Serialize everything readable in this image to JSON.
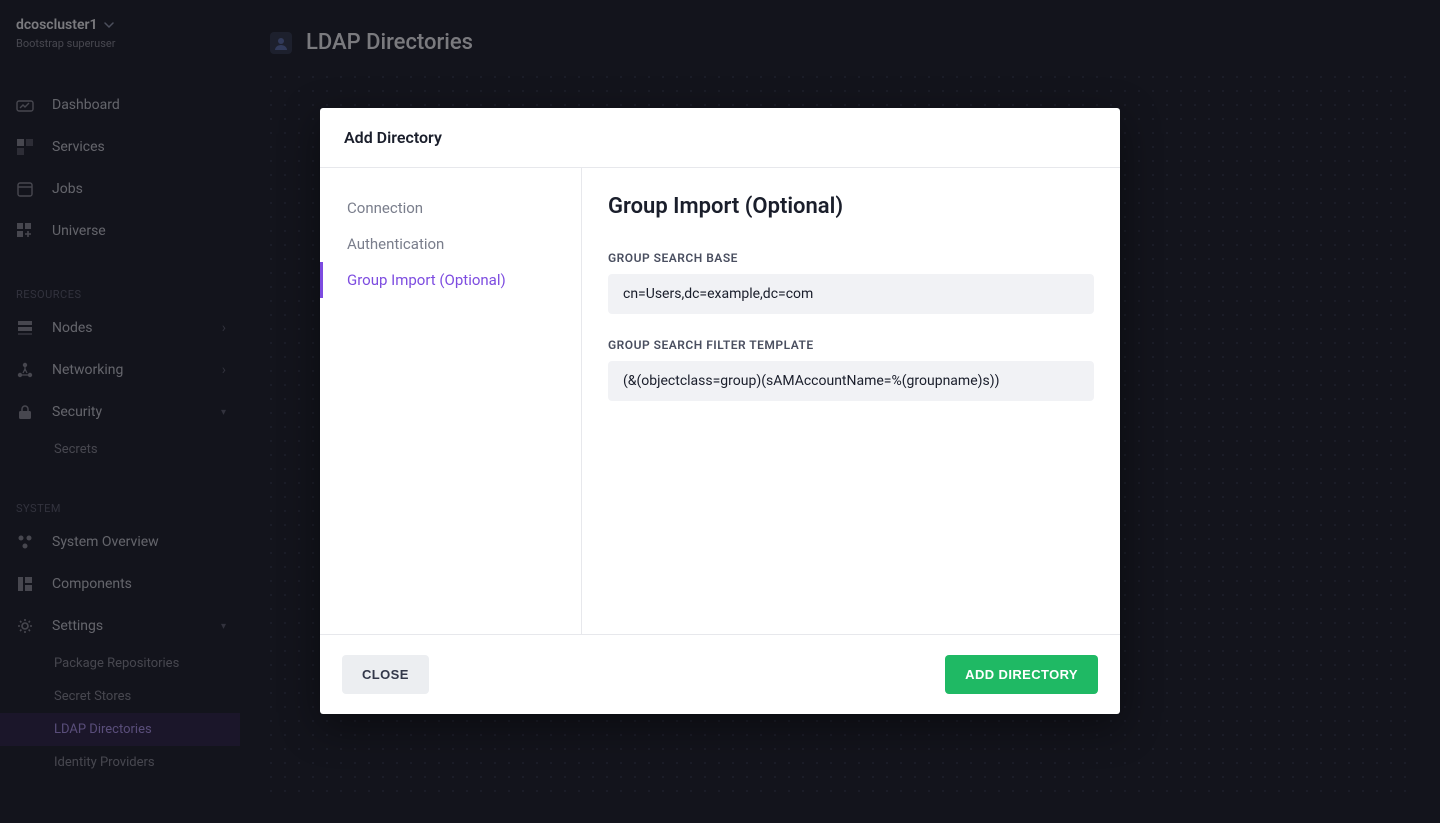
{
  "cluster": {
    "name": "dcoscluster1",
    "sub": "Bootstrap superuser"
  },
  "nav": {
    "top": [
      {
        "label": "Dashboard"
      },
      {
        "label": "Services"
      },
      {
        "label": "Jobs"
      },
      {
        "label": "Universe"
      }
    ],
    "resources_heading": "RESOURCES",
    "resources": [
      {
        "label": "Nodes"
      },
      {
        "label": "Networking"
      },
      {
        "label": "Security"
      }
    ],
    "security_sub": [
      {
        "label": "Secrets"
      }
    ],
    "system_heading": "SYSTEM",
    "system": [
      {
        "label": "System Overview"
      },
      {
        "label": "Components"
      },
      {
        "label": "Settings"
      }
    ],
    "settings_sub": [
      {
        "label": "Package Repositories"
      },
      {
        "label": "Secret Stores"
      },
      {
        "label": "LDAP Directories"
      },
      {
        "label": "Identity Providers"
      }
    ]
  },
  "page": {
    "title": "LDAP Directories"
  },
  "modal": {
    "title": "Add Directory",
    "tabs": [
      {
        "label": "Connection"
      },
      {
        "label": "Authentication"
      },
      {
        "label": "Group Import (Optional)"
      }
    ],
    "panel_title": "Group Import (Optional)",
    "fields": {
      "search_base_label": "GROUP SEARCH BASE",
      "search_base_value": "cn=Users,dc=example,dc=com",
      "filter_label": "GROUP SEARCH FILTER TEMPLATE",
      "filter_value": "(&(objectclass=group)(sAMAccountName=%(groupname)s))"
    },
    "buttons": {
      "close": "CLOSE",
      "submit": "ADD DIRECTORY"
    }
  }
}
